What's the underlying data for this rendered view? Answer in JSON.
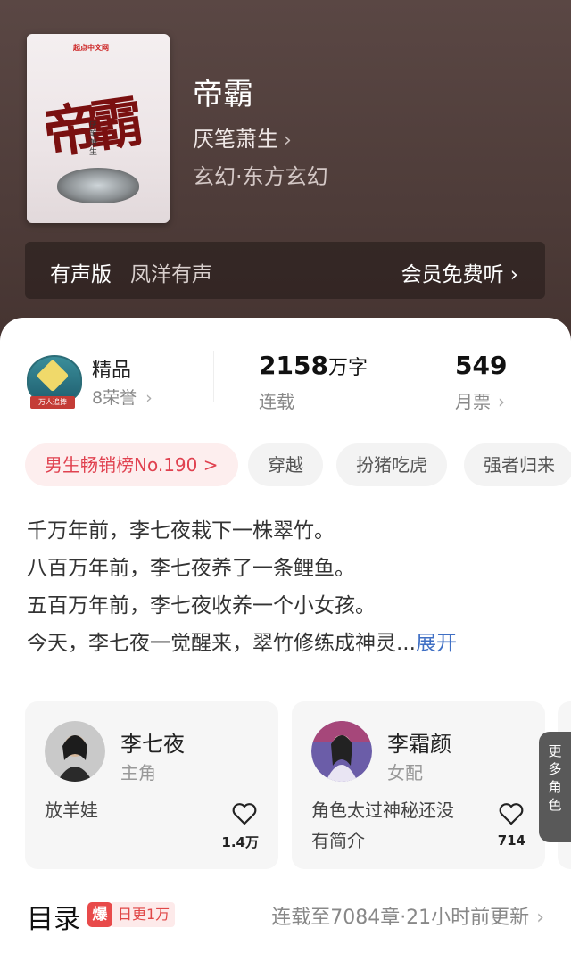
{
  "book": {
    "cover_publisher": "起点中文网",
    "cover_title": "帝霸",
    "cover_author": "厌笔萧生",
    "title": "帝霸",
    "author": "厌笔萧生",
    "genre": "玄幻·东方玄幻"
  },
  "audio": {
    "label": "有声版",
    "narrator": "凤洋有声",
    "action": "会员免费听"
  },
  "stats": {
    "badge_ribbon": "万人追捧",
    "quality": "精品",
    "honors": "8荣誉",
    "words_number": "2158",
    "words_unit": "万字",
    "status": "连载",
    "tickets_number": "549",
    "tickets_label": "月票"
  },
  "tags": [
    {
      "label": "男生畅销榜No.190 >"
    },
    {
      "label": "穿越"
    },
    {
      "label": "扮猪吃虎"
    },
    {
      "label": "强者归来"
    }
  ],
  "description": {
    "lines": [
      "千万年前，李七夜栽下一株翠竹。",
      "八百万年前，李七夜养了一条鲤鱼。",
      "五百万年前，李七夜收养一个小女孩。",
      "今天，李七夜一觉醒来，翠竹修练成神灵..."
    ],
    "more": "展开"
  },
  "characters": [
    {
      "name": "李七夜",
      "role": "主角",
      "note": "放羊娃",
      "likes": "1.4万"
    },
    {
      "name": "李霜颜",
      "role": "女配",
      "note": "角色太过神秘还没有简介",
      "likes": "714"
    }
  ],
  "more_roles": "更多角色",
  "toc": {
    "title": "目录",
    "burst_icon": "爆",
    "burst_text": "日更1万",
    "status": "连载至7084章·21小时前更新"
  },
  "colors": {
    "hero_bg": "#4e3c39",
    "accent_red": "#e0414f",
    "link_blue": "#3f6fc4"
  }
}
